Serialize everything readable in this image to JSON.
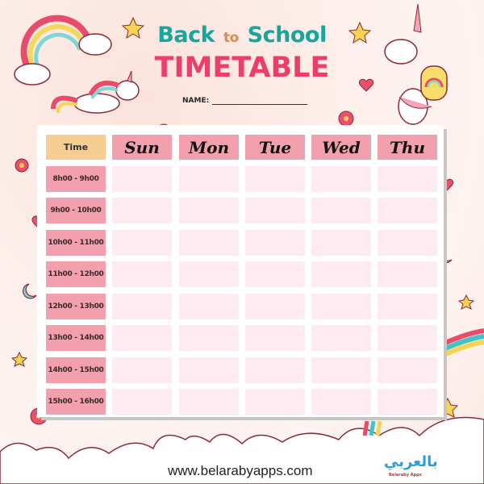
{
  "header": {
    "title_part1": "Back",
    "title_connector": "to",
    "title_part2": "School",
    "subtitle": "TIMETABLE",
    "name_label": "NAME:"
  },
  "table": {
    "time_header": "Time",
    "days": [
      "Sun",
      "Mon",
      "Tue",
      "Wed",
      "Thu"
    ],
    "time_slots": [
      "8h00 - 9h00",
      "9h00 - 10h00",
      "10h00 - 11h00",
      "11h00 - 12h00",
      "12h00 - 13h00",
      "13h00 - 14h00",
      "14h00 - 15h00",
      "15h00 - 16h00"
    ]
  },
  "footer": {
    "website": "www.belarabyapps.com",
    "logo_text": "بالعربي",
    "logo_subtext": "Belaraby Apps"
  },
  "colors": {
    "title_teal": "#17a59d",
    "title_orange": "#d98a4f",
    "title_pink": "#ec3e6e",
    "time_header_bg": "#f6ce94",
    "day_header_bg": "#f2a0ad",
    "slot_bg": "#fdebf1"
  }
}
